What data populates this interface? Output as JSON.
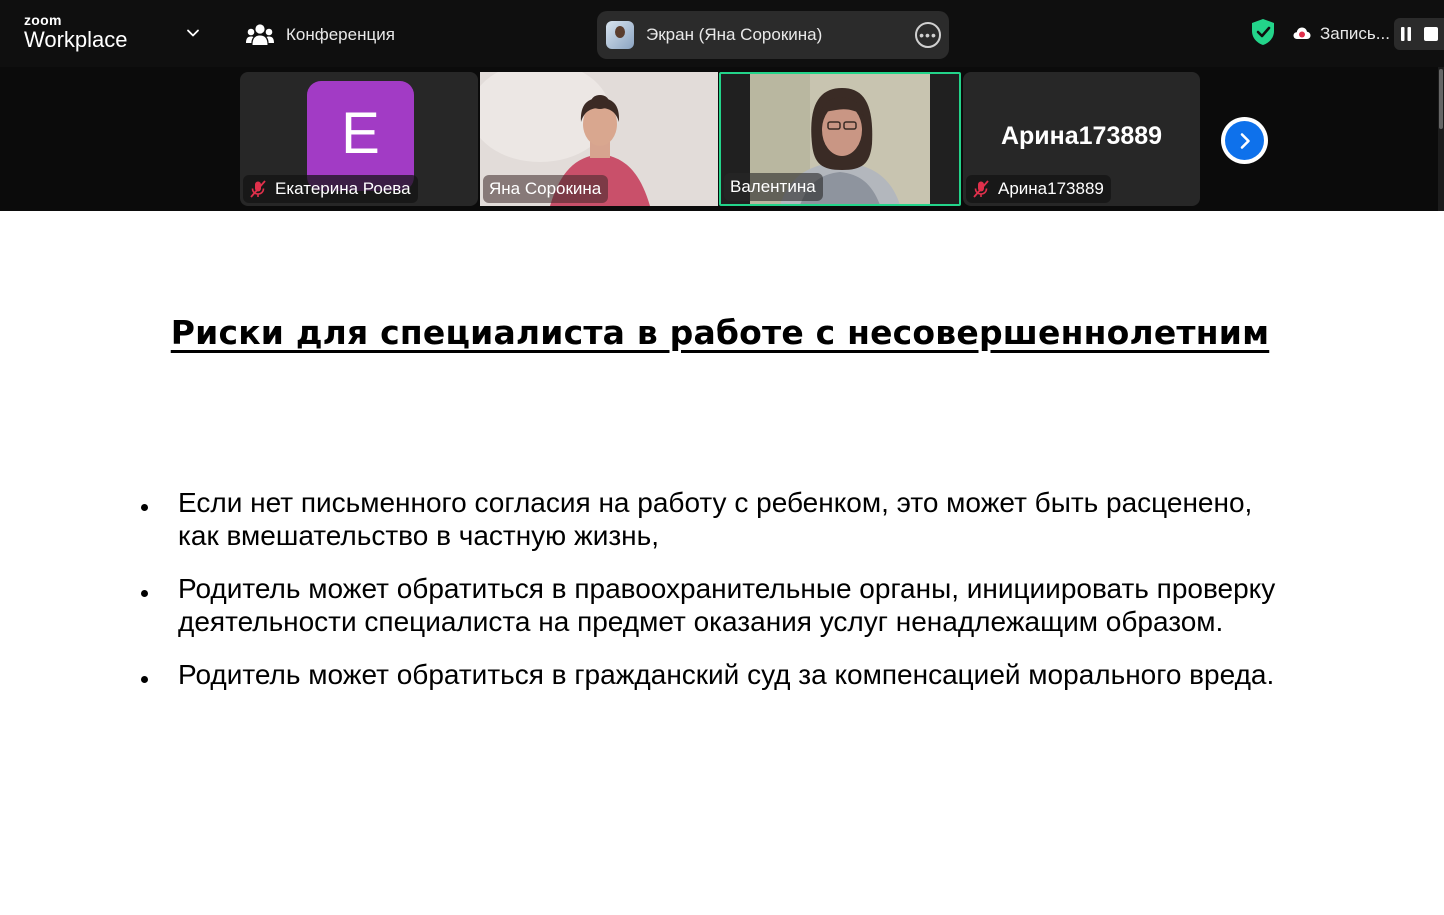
{
  "app": {
    "logo_top": "zoom",
    "logo_bottom": "Workplace",
    "meeting_label": "Конференция",
    "share_label": "Экран (Яна Сорокина)",
    "recording_label": "Запись...",
    "shield_color": "#23d48a",
    "accent_color": "#0e71eb"
  },
  "participants": [
    {
      "name": "Екатерина Роева",
      "initial": "E",
      "muted": true,
      "avatar_color": "#a23bc5"
    },
    {
      "name": "Яна Сорокина",
      "muted": false
    },
    {
      "name": "Валентина",
      "muted": false,
      "active_speaker": true
    },
    {
      "name": "Арина173889",
      "display_name": "Арина173889",
      "muted": true
    }
  ],
  "slide": {
    "title": "Риски для специалиста в работе с несовершеннолетним",
    "bullets": [
      "Если нет письменного согласия на работу с ребенком, это может быть расценено, как вмешательство в частную жизнь,",
      "Родитель может обратиться в правоохранительные органы, инициировать проверку деятельности специалиста на предмет оказания услуг ненадлежащим образом.",
      "Родитель может обратиться в гражданский суд за компенсацией морального вреда."
    ]
  }
}
